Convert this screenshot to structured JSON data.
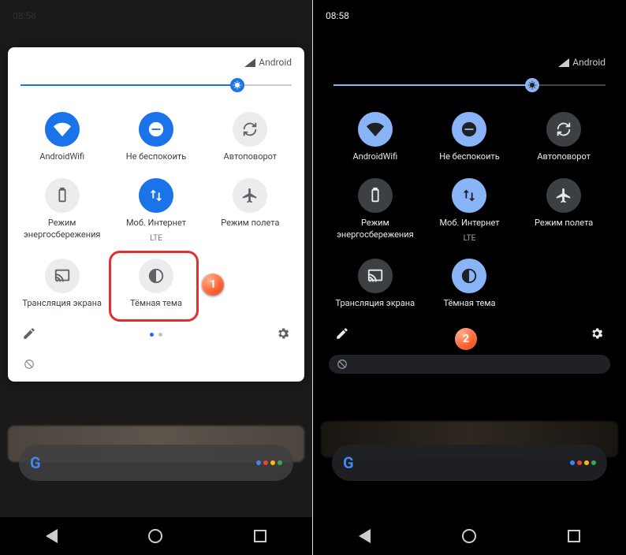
{
  "time": "08:58",
  "carrier": "Android",
  "tiles": {
    "wifi": {
      "label": "AndroidWifi",
      "sub": ""
    },
    "dnd": {
      "label": "Не беспокоить",
      "sub": ""
    },
    "rotate": {
      "label": "Автоповорот",
      "sub": ""
    },
    "battery": {
      "label": "Режим энергосбережения",
      "sub": ""
    },
    "mobile": {
      "label": "Моб. Интернет",
      "sub": "LTE"
    },
    "airplane": {
      "label": "Режим полета",
      "sub": ""
    },
    "cast": {
      "label": "Трансляция экрана",
      "sub": ""
    },
    "dark": {
      "label": "Тёмная тема",
      "sub": ""
    }
  },
  "markers": {
    "m1": "1",
    "m2": "2"
  }
}
